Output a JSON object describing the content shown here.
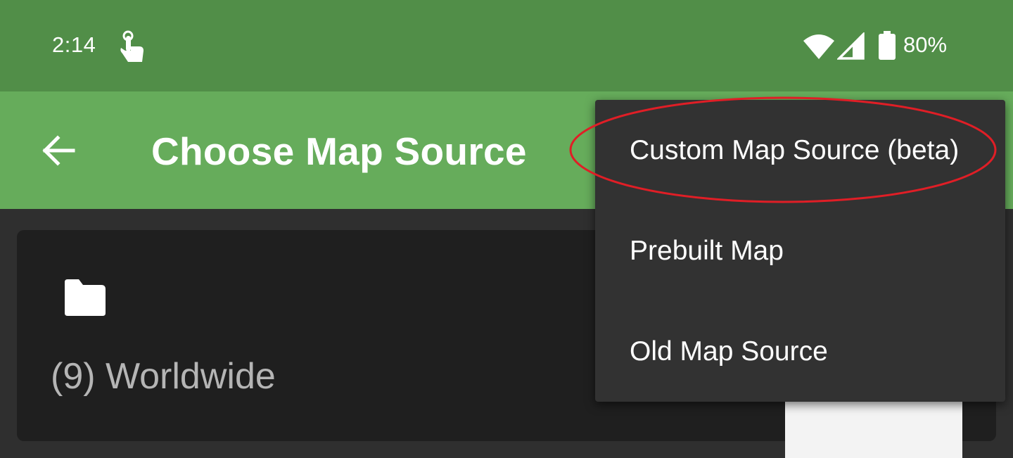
{
  "status_bar": {
    "time": "2:14",
    "battery": "80%",
    "icons": [
      "touch-icon",
      "wifi-icon",
      "signal-icon",
      "battery-icon"
    ]
  },
  "app_bar": {
    "title": "Choose Map Source",
    "back_icon": "arrow-back-icon"
  },
  "list": {
    "items": [
      {
        "label": "(9) Worldwide",
        "icon": "folder-icon"
      }
    ]
  },
  "menu": {
    "items": [
      {
        "label": "Custom Map Source (beta)"
      },
      {
        "label": "Prebuilt Map"
      },
      {
        "label": "Old Map Source"
      }
    ]
  },
  "annotation": {
    "highlight_color": "#e01e26"
  },
  "colors": {
    "status_bar": "#518e48",
    "app_bar": "#66ac5b",
    "background": "#2f2f2f",
    "card": "#1f1f1f",
    "menu": "#323232"
  }
}
